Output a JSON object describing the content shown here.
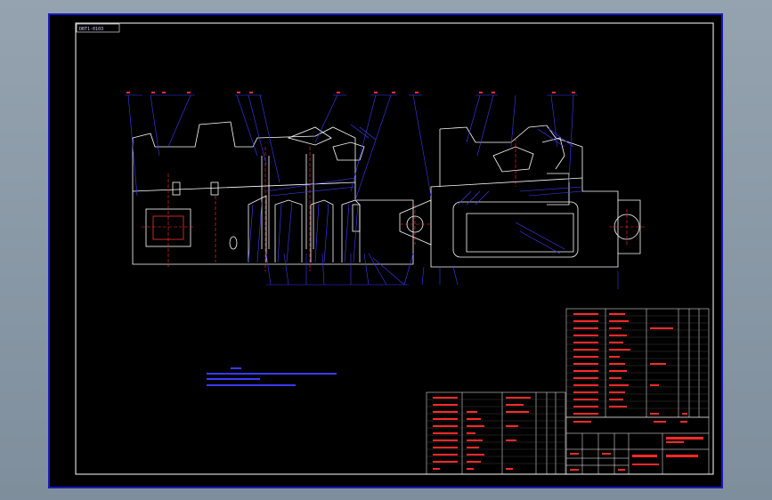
{
  "drawing": {
    "corner_tag": "DBT1-0103",
    "colors": {
      "frame": "#2222ff",
      "outline": "#ffffff",
      "hatch": "#4444ff",
      "centerline": "#ff3030",
      "text": "#ff2a2a",
      "viewport": "#8c9aa8"
    }
  }
}
